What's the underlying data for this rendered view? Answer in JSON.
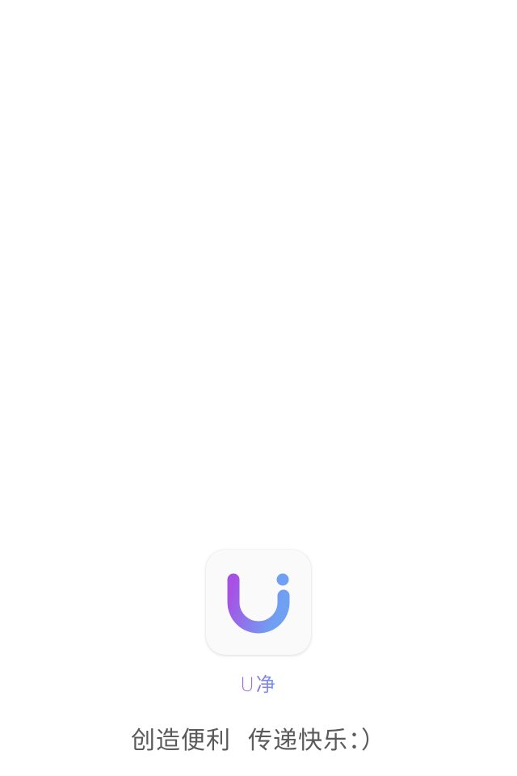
{
  "app": {
    "name": "U净",
    "slogan": "创造便利  传递快乐：）"
  },
  "logo": {
    "icon": "u-smile-logo-icon",
    "gradient_start": "#a84fe4",
    "gradient_end": "#6fa0f2"
  },
  "colors": {
    "background": "#ffffff",
    "slogan_text": "#5a5a5a"
  }
}
